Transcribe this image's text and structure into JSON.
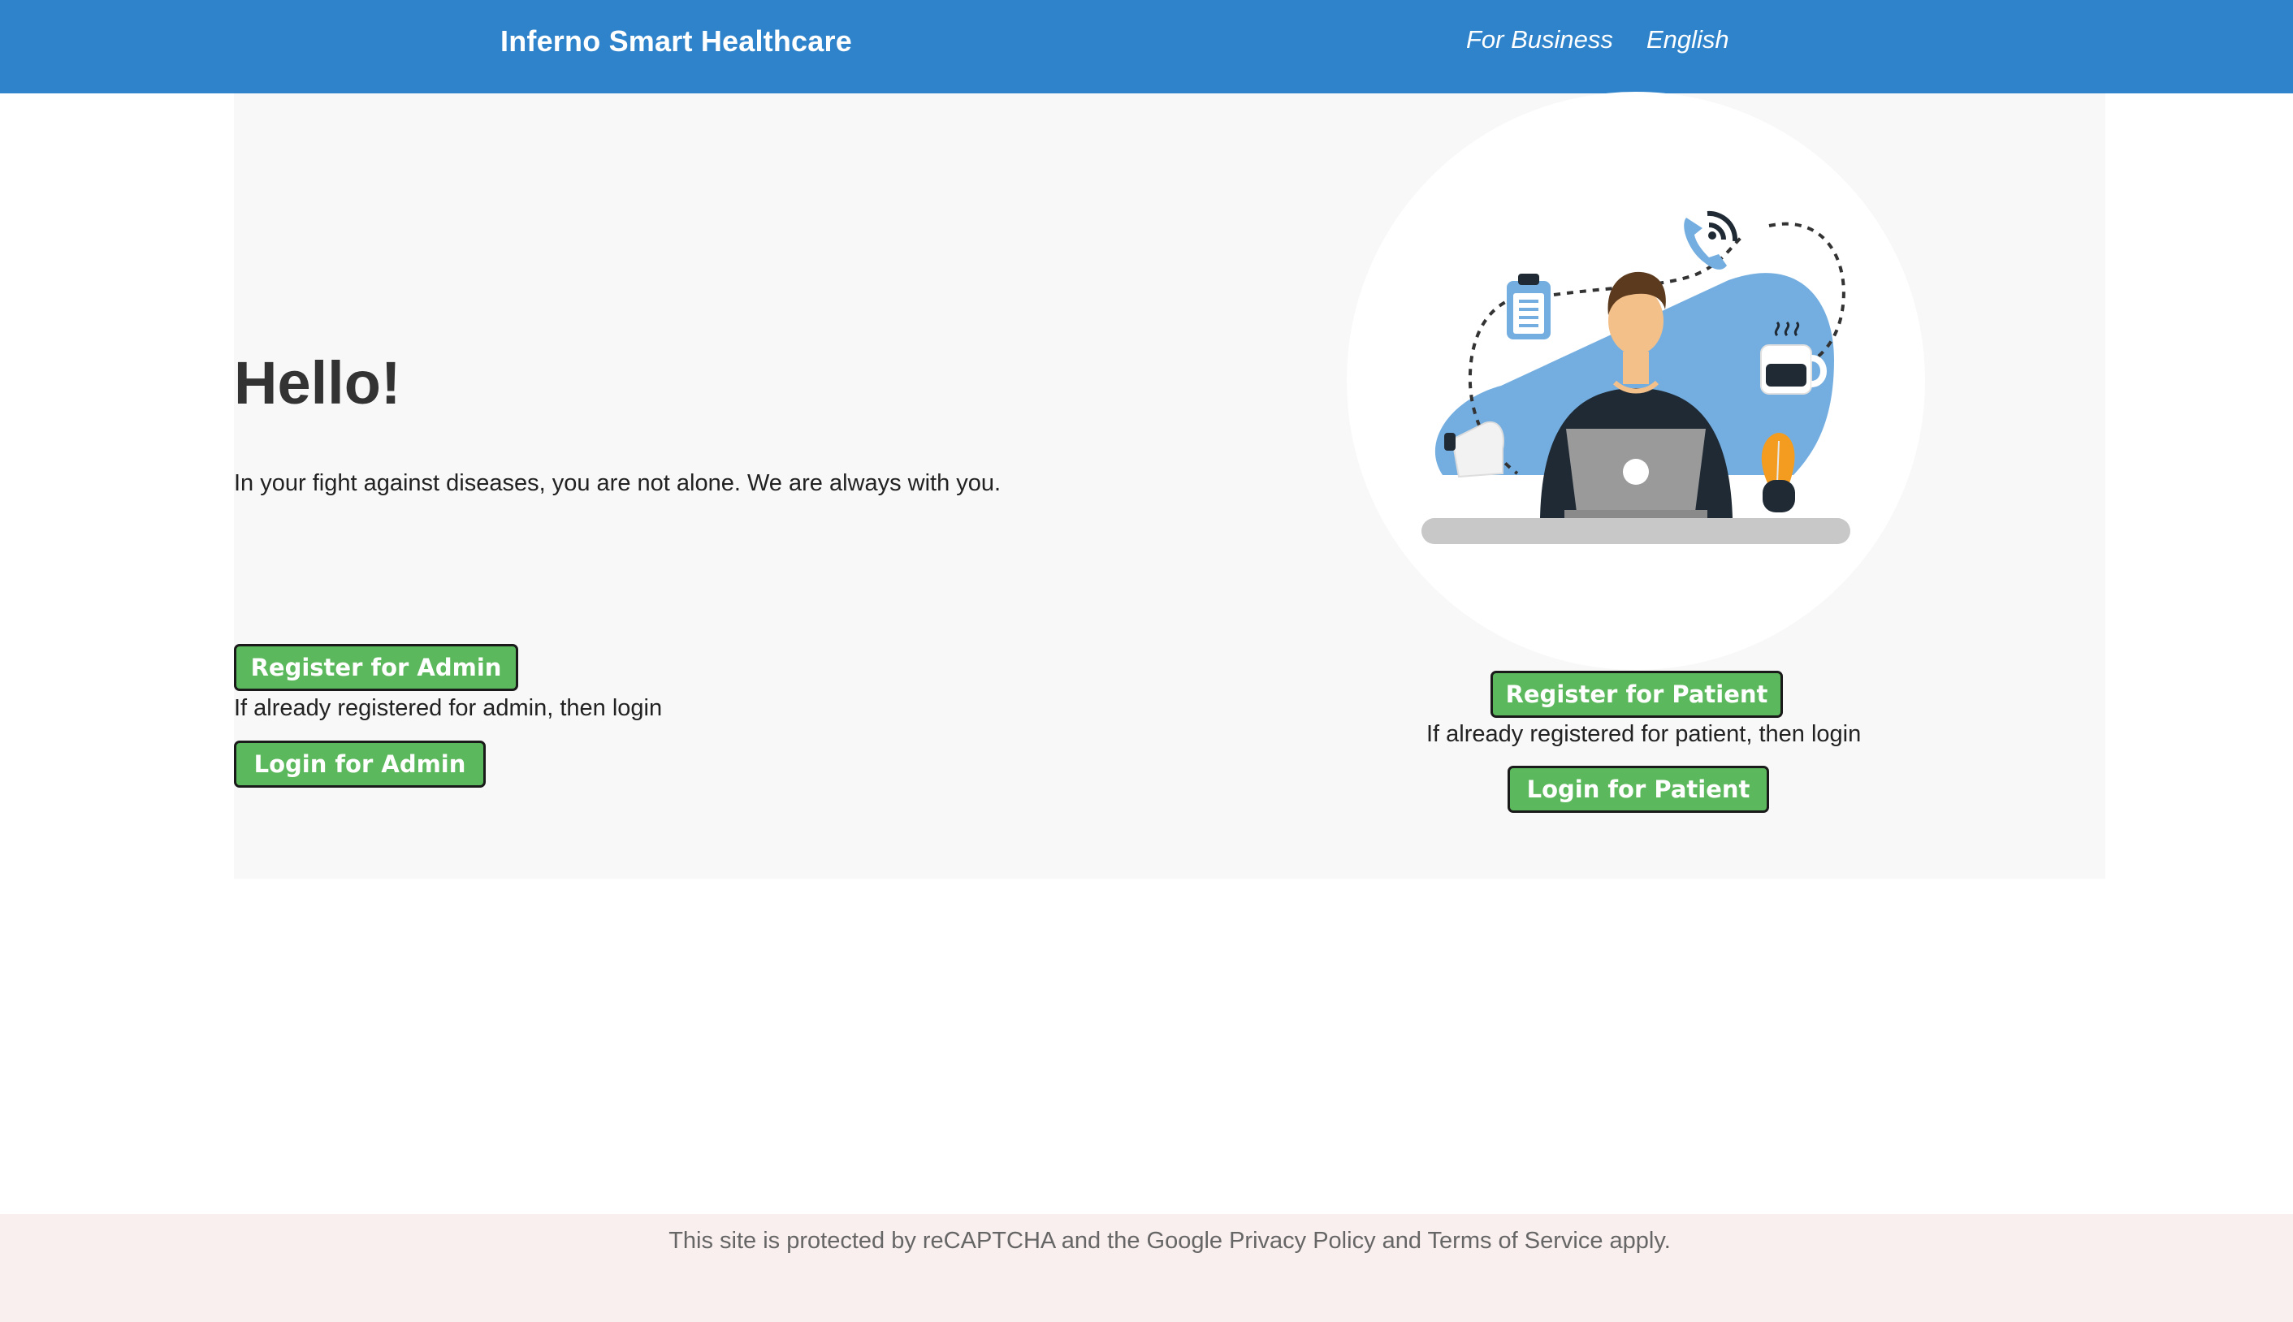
{
  "navbar": {
    "brand": "Inferno Smart Healthcare",
    "links": [
      "For Business",
      "English"
    ]
  },
  "hero": {
    "heading": "Hello!",
    "tagline": "In your fight against diseases, you are not alone. We are always with you.",
    "admin": {
      "register_label": "Register for Admin",
      "hint": "If already registered for admin, then login",
      "login_label": "Login for Admin"
    },
    "patient": {
      "register_label": "Register for Patient",
      "hint": "If already registered for patient, then login",
      "login_label": "Login for Patient"
    }
  },
  "footer": {
    "text": "This site is protected by reCAPTCHA and the Google Privacy Policy and Terms of Service apply."
  },
  "colors": {
    "navbar": "#2f83cb",
    "button": "#5cb85c",
    "panel": "#f8f8f8",
    "footer": "#f9efee"
  }
}
